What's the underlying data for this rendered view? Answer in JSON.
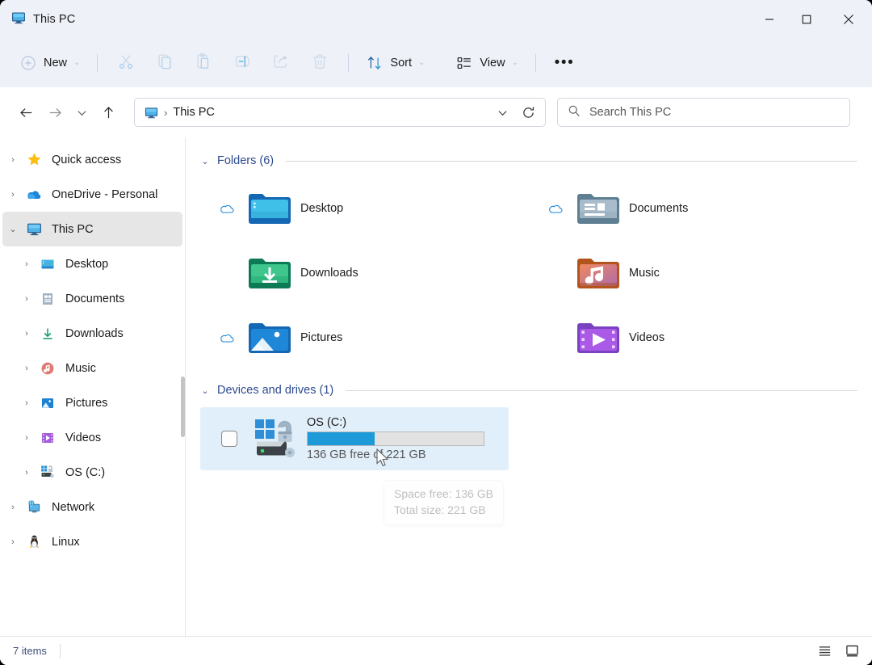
{
  "window": {
    "title": "This PC",
    "title_icon": "monitor-icon",
    "controls": {
      "minimize": "─",
      "maximize": "□",
      "close": "✕"
    }
  },
  "toolbar": {
    "new_label": "New",
    "new_icon": "plus-circle-icon",
    "sort_label": "Sort",
    "sort_icon": "sort-arrows-icon",
    "view_label": "View",
    "view_icon": "view-list-icon",
    "more_label": "•••",
    "actions": [
      {
        "name": "cut",
        "icon": "scissors-icon"
      },
      {
        "name": "copy",
        "icon": "copy-icon"
      },
      {
        "name": "paste",
        "icon": "clipboard-icon"
      },
      {
        "name": "rename",
        "icon": "rename-icon"
      },
      {
        "name": "share",
        "icon": "share-icon"
      },
      {
        "name": "delete",
        "icon": "trash-icon"
      }
    ]
  },
  "addressbar": {
    "back_icon": "arrow-left-icon",
    "forward_icon": "arrow-right-icon",
    "recent_icon": "chevron-down-icon",
    "up_icon": "arrow-up-icon",
    "crumb_icon": "monitor-icon",
    "crumb_separator": "›",
    "path": "This PC",
    "dropdown_icon": "chevron-down-icon",
    "refresh_icon": "refresh-icon"
  },
  "search": {
    "icon": "search-icon",
    "placeholder": "Search This PC",
    "value": ""
  },
  "sidebar": {
    "items": [
      {
        "label": "Quick access",
        "icon": "star-icon",
        "expander": "›",
        "indent": 0,
        "selected": false
      },
      {
        "label": "OneDrive - Personal",
        "icon": "onedrive-cloud-icon",
        "expander": "›",
        "indent": 0,
        "selected": false
      },
      {
        "label": "This PC",
        "icon": "monitor-icon",
        "expander": "⌄",
        "indent": 0,
        "selected": true
      },
      {
        "label": "Desktop",
        "icon": "desktop-folder-icon",
        "expander": "›",
        "indent": 1,
        "selected": false
      },
      {
        "label": "Documents",
        "icon": "documents-folder-icon",
        "expander": "›",
        "indent": 1,
        "selected": false
      },
      {
        "label": "Downloads",
        "icon": "downloads-icon",
        "expander": "›",
        "indent": 1,
        "selected": false
      },
      {
        "label": "Music",
        "icon": "music-icon",
        "expander": "›",
        "indent": 1,
        "selected": false
      },
      {
        "label": "Pictures",
        "icon": "pictures-icon",
        "expander": "›",
        "indent": 1,
        "selected": false
      },
      {
        "label": "Videos",
        "icon": "videos-icon",
        "expander": "›",
        "indent": 1,
        "selected": false
      },
      {
        "label": "OS (C:)",
        "icon": "drive-icon",
        "expander": "›",
        "indent": 1,
        "selected": false
      },
      {
        "label": "Network",
        "icon": "network-icon",
        "expander": "›",
        "indent": 0,
        "selected": false
      },
      {
        "label": "Linux",
        "icon": "linux-penguin-icon",
        "expander": "›",
        "indent": 0,
        "selected": false
      }
    ]
  },
  "content": {
    "folders_group": {
      "title": "Folders (6)",
      "chevron": "⌄",
      "items": [
        {
          "name": "Desktop",
          "icon": "desktop-folder-icon",
          "cloud": true
        },
        {
          "name": "Documents",
          "icon": "documents-folder-icon",
          "cloud": true
        },
        {
          "name": "Downloads",
          "icon": "downloads-folder-icon",
          "cloud": false
        },
        {
          "name": "Music",
          "icon": "music-folder-icon",
          "cloud": false
        },
        {
          "name": "Pictures",
          "icon": "pictures-folder-icon",
          "cloud": true
        },
        {
          "name": "Videos",
          "icon": "videos-folder-icon",
          "cloud": false
        }
      ]
    },
    "drives_group": {
      "title": "Devices and drives (1)",
      "chevron": "⌄",
      "drive": {
        "name": "OS (C:)",
        "free_text": "136 GB free of 221 GB",
        "used_percent": 38,
        "selected": true,
        "checkbox_checked": false,
        "icon": "windows-drive-bitlocker-unlocked-icon"
      }
    },
    "tooltip": {
      "line1": "Space free: 136 GB",
      "line2": "Total size: 221 GB"
    }
  },
  "statusbar": {
    "items_count": "7 items",
    "view_details_icon": "details-view-icon",
    "view_large_icon": "large-icons-view-icon"
  },
  "colors": {
    "accent": "#1e9ad8",
    "chrome": "#eef1f8",
    "group_title": "#2c4a8e",
    "selection": "#e1effb",
    "sidebar_selected": "#e6e6e6"
  }
}
